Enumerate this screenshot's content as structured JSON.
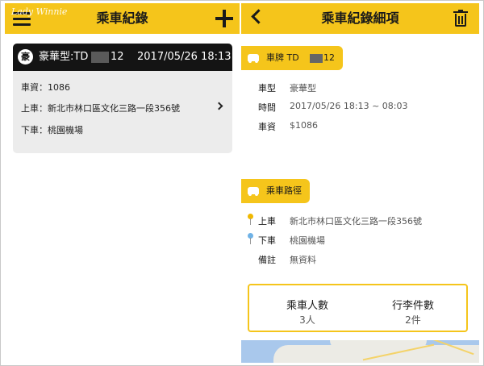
{
  "watermark": "Lady Winnie",
  "left": {
    "title": "乘車紀錄",
    "record": {
      "badge": "豪",
      "car_type_plate": "豪華型:TD",
      "plate_tail": "12",
      "datetime": "2017/05/26 18:13",
      "fare": "車資：1086",
      "pickup": "上車：新北市林口區文化三路一段356號",
      "dropoff": "下車：桃園機場"
    }
  },
  "right": {
    "title": "乘車紀錄細項",
    "plate_tab": {
      "prefix": "車牌 TD",
      "suffix": "12"
    },
    "details": [
      {
        "label": "車型",
        "value": "豪華型"
      },
      {
        "label": "時間",
        "value": "2017/05/26 18:13 ~ 08:03"
      },
      {
        "label": "車資",
        "value": "$1086"
      }
    ],
    "route_tab": "乘車路徑",
    "route": [
      {
        "label": "上車",
        "value": "新北市林口區文化三路一段356號",
        "pin_color": "#f0b800"
      },
      {
        "label": "下車",
        "value": "桃園機場",
        "pin_color": "#6fb2e6"
      },
      {
        "label": "備註",
        "value": "無資料"
      }
    ],
    "counts": [
      {
        "title": "乘車人數",
        "value": "3人"
      },
      {
        "title": "行李件數",
        "value": "2件"
      }
    ]
  }
}
